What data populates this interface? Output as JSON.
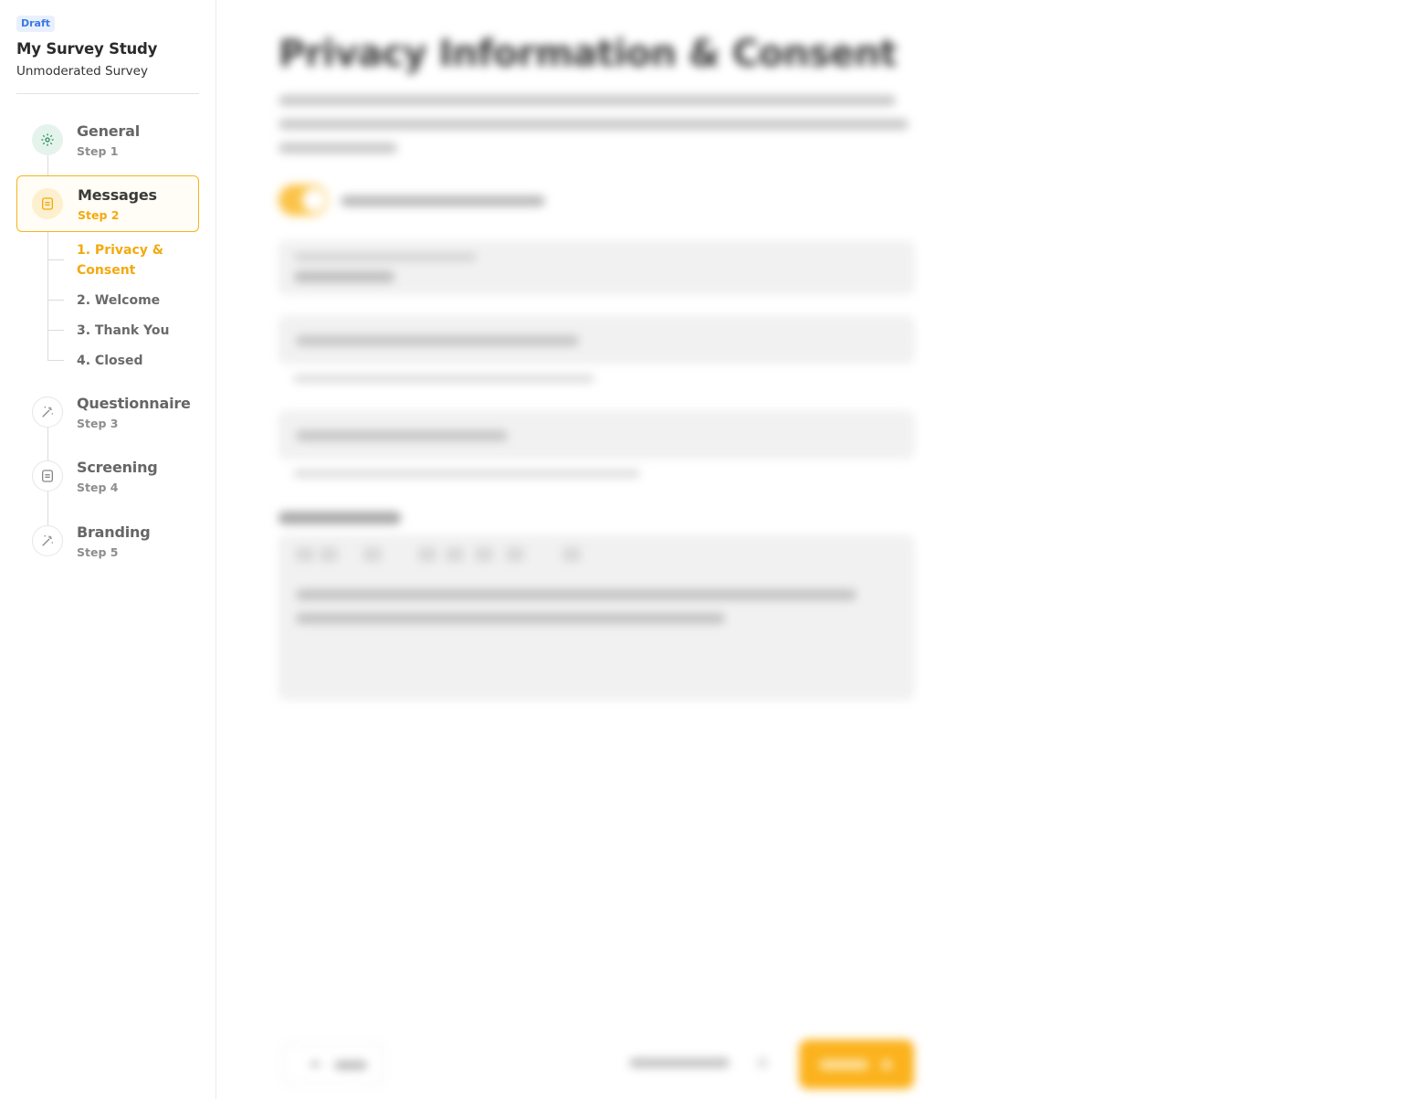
{
  "study": {
    "status": "Draft",
    "title": "My Survey Study",
    "type": "Unmoderated Survey"
  },
  "steps": [
    {
      "name": "General",
      "num": "Step 1",
      "icon": "gear-icon",
      "state": "done"
    },
    {
      "name": "Messages",
      "num": "Step 2",
      "icon": "message-icon",
      "state": "current"
    },
    {
      "name": "Questionnaire",
      "num": "Step 3",
      "icon": "magic-wand-icon",
      "state": "todo"
    },
    {
      "name": "Screening",
      "num": "Step 4",
      "icon": "message-icon",
      "state": "todo"
    },
    {
      "name": "Branding",
      "num": "Step 5",
      "icon": "magic-wand-icon",
      "state": "todo"
    }
  ],
  "substeps": [
    {
      "label": "1. Privacy & Consent",
      "active": true
    },
    {
      "label": "2. Welcome",
      "active": false
    },
    {
      "label": "3. Thank You",
      "active": false
    },
    {
      "label": "4. Closed",
      "active": false
    }
  ],
  "main": {
    "heading": "Privacy Information & Consent"
  },
  "colors": {
    "accent": "#fbb21c",
    "accent_text": "#f3a90f",
    "done_green": "#2e8f5e",
    "badge_blue": "#3b78e7"
  }
}
